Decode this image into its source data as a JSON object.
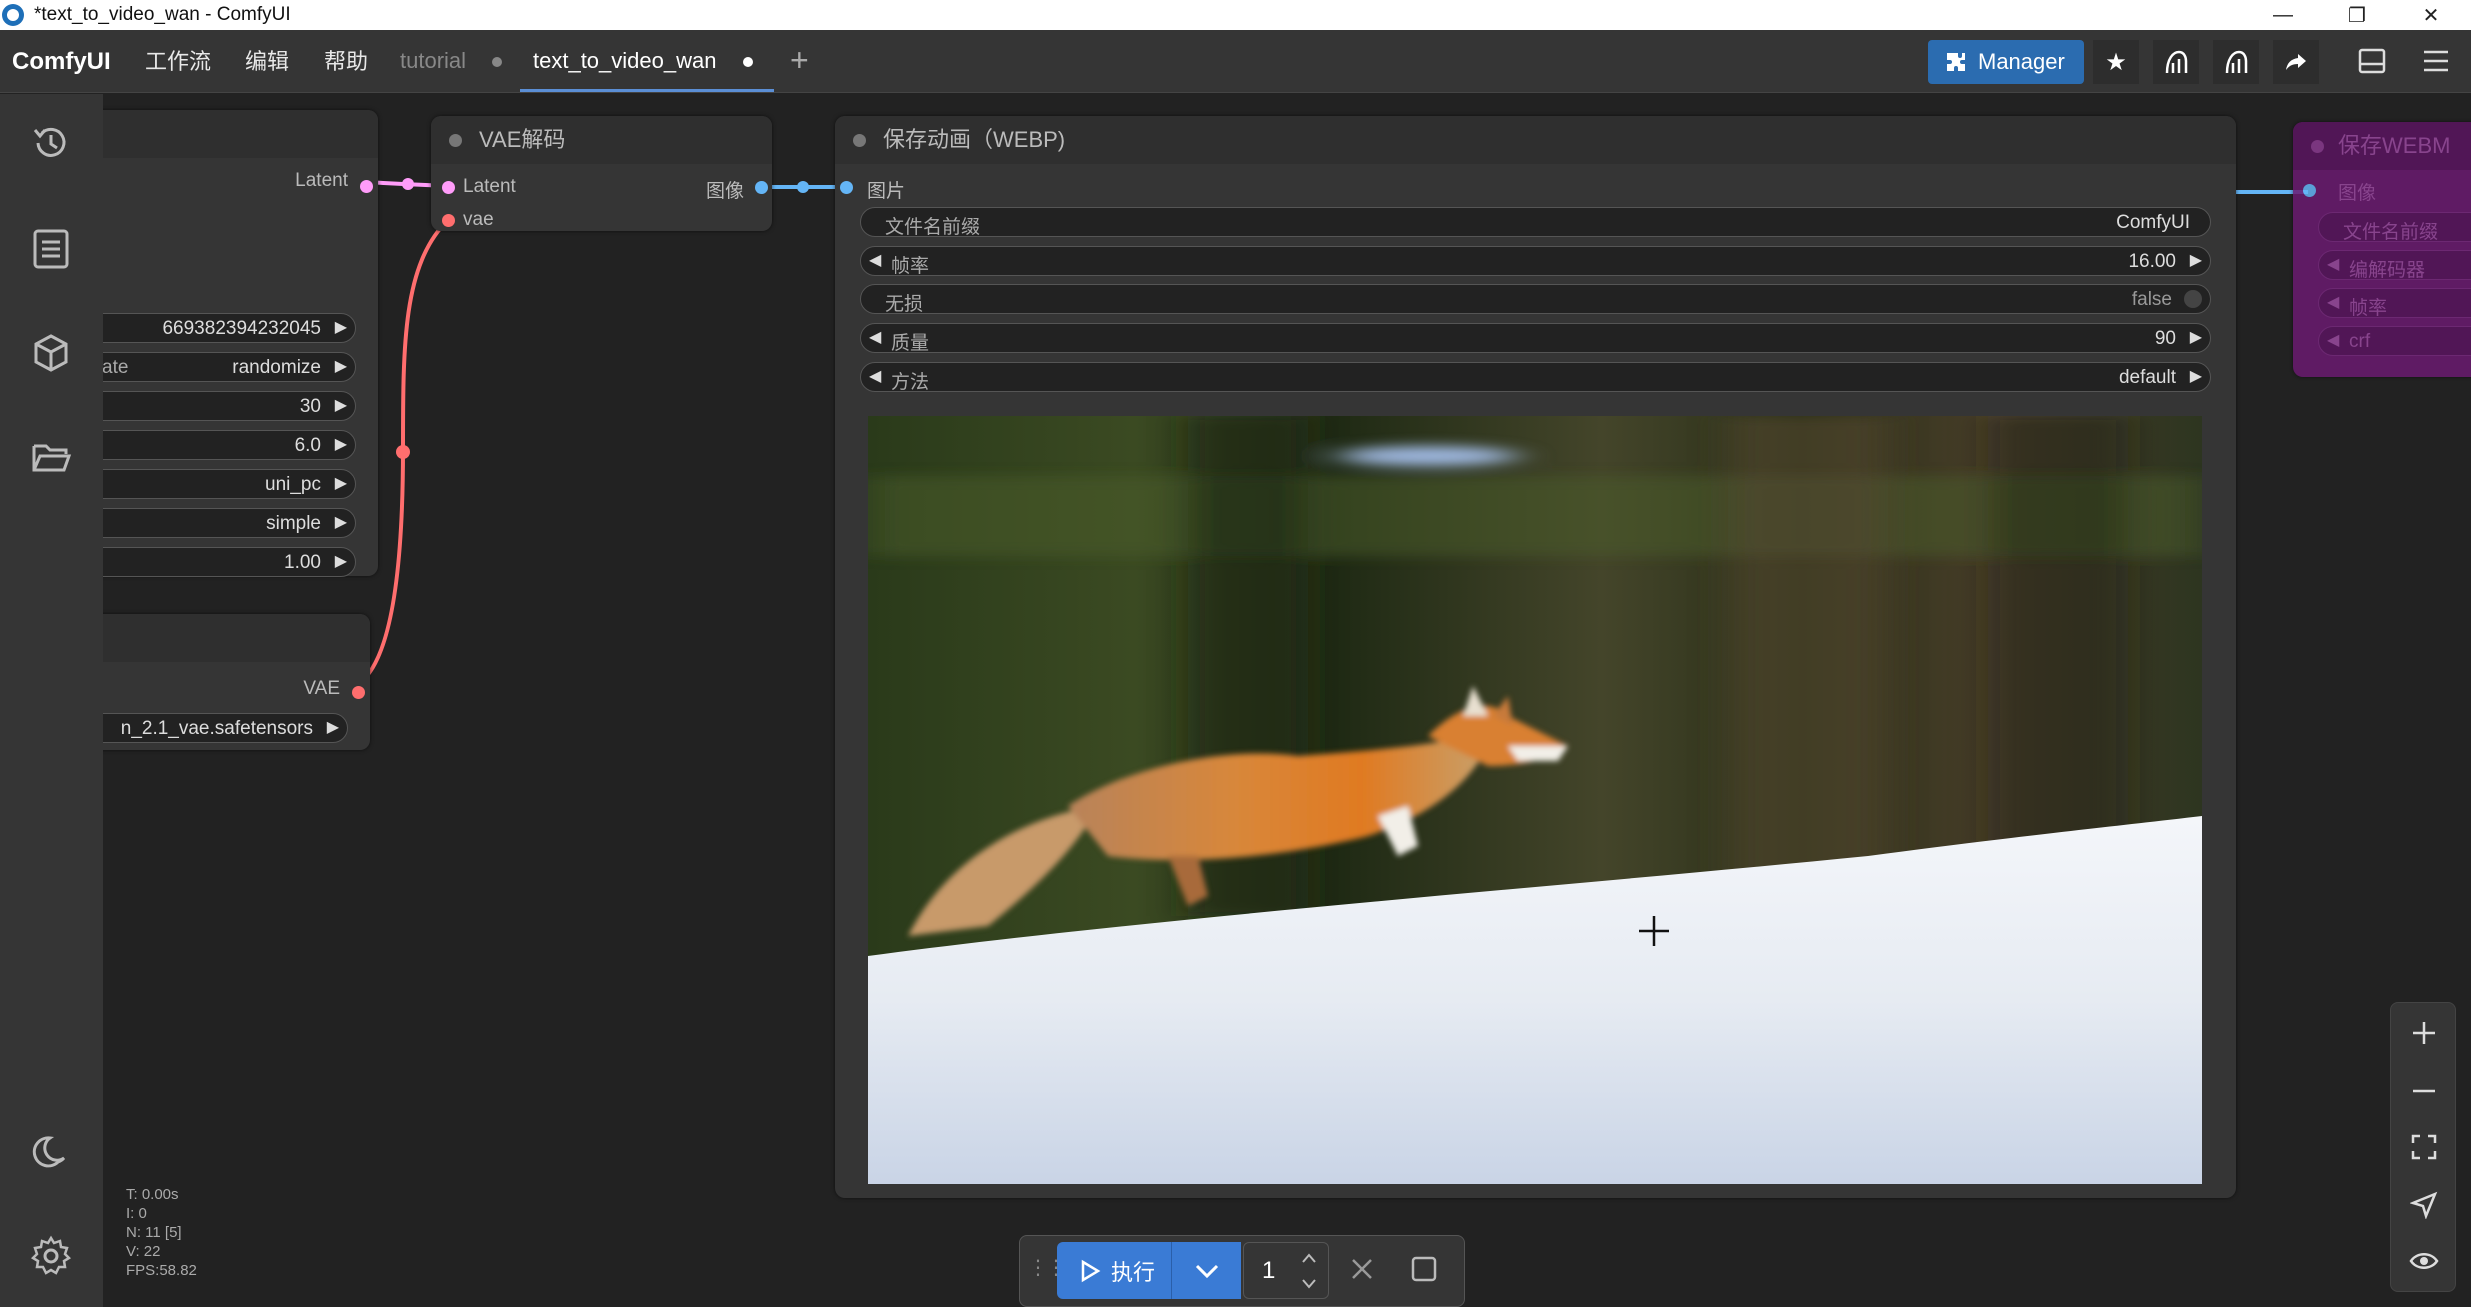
{
  "window": {
    "title": "*text_to_video_wan - ComfyUI",
    "minimize": "—",
    "restore": "❐",
    "close": "✕"
  },
  "menubar": {
    "logo": "ComfyUI",
    "menus": [
      "工作流",
      "编辑",
      "帮助"
    ],
    "tabs": [
      {
        "label": "tutorial",
        "active": false
      },
      {
        "label": "text_to_video_wan",
        "active": true
      }
    ],
    "new_tab": "+",
    "manager_label": "Manager"
  },
  "sampler_node": {
    "output_label": "Latent",
    "widgets": [
      {
        "label": "",
        "value": "669382394232045"
      },
      {
        "label": "ate",
        "value": "randomize"
      },
      {
        "label": "",
        "value": "30"
      },
      {
        "label": "",
        "value": "6.0"
      },
      {
        "label": "",
        "value": "uni_pc"
      },
      {
        "label": "",
        "value": "simple"
      },
      {
        "label": "",
        "value": "1.00"
      }
    ]
  },
  "vae_loader_node": {
    "output_label": "VAE",
    "widget_value": "n_2.1_vae.safetensors"
  },
  "vae_decode_node": {
    "title": "VAE解码",
    "inputs": [
      "Latent",
      "vae"
    ],
    "output_label": "图像"
  },
  "save_anim_node": {
    "title": "保存动画（WEBP)",
    "input_label": "图片",
    "widgets": [
      {
        "label": "文件名前缀",
        "value": "ComfyUI",
        "arrows": false
      },
      {
        "label": "帧率",
        "value": "16.00",
        "arrows": true
      },
      {
        "label": "无损",
        "value": "false",
        "arrows": false,
        "toggle": true
      },
      {
        "label": "质量",
        "value": "90",
        "arrows": true
      },
      {
        "label": "方法",
        "value": "default",
        "arrows": true
      }
    ]
  },
  "save_webm_node": {
    "title": "保存WEBM",
    "input_label": "图像",
    "widgets": [
      "文件名前缀",
      "编解码器",
      "帧率",
      "crf"
    ]
  },
  "stats": {
    "t": "T: 0.00s",
    "i": "I: 0",
    "n": "N: 11 [5]",
    "v": "V: 22",
    "fps": "FPS:58.82"
  },
  "runbar": {
    "run_label": "执行",
    "batch_count": "1"
  },
  "colors": {
    "latent_link": "#ff9cf9",
    "vae_link": "#ff6e6e",
    "image_link": "#64b5f6",
    "run_button": "#3a7bd5",
    "manager_button": "#2b6cb0"
  }
}
